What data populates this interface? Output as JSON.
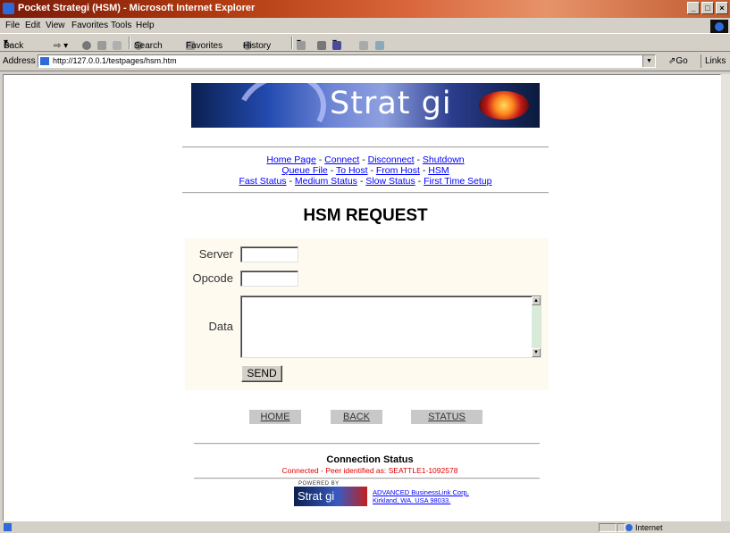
{
  "window": {
    "title": "Pocket Strategi (HSM) - Microsoft Internet Explorer",
    "controls": [
      "_",
      "□",
      "×"
    ]
  },
  "menu": [
    "File",
    "Edit",
    "View",
    "Favorites",
    "Tools",
    "Help"
  ],
  "toolbar": {
    "back": "Back",
    "search": "Search",
    "favorites": "Favorites",
    "history": "History"
  },
  "address": {
    "label": "Address",
    "url": "http://127.0.0.1/testpages/hsm.htm",
    "go": "Go",
    "links": "Links"
  },
  "page": {
    "logo_text": "Strat gi",
    "nav_row1": [
      "Home Page",
      "Connect",
      "Disconnect",
      "Shutdown"
    ],
    "nav_row2": [
      "Queue File",
      "To Host",
      "From Host",
      "HSM"
    ],
    "nav_row3": [
      "Fast Status",
      "Medium Status",
      "Slow Status",
      "First Time Setup"
    ],
    "separator": " - ",
    "heading": "HSM REQUEST",
    "form": {
      "server_label": "Server",
      "server_value": "",
      "opcode_label": "Opcode",
      "opcode_value": "",
      "data_label": "Data",
      "data_value": "",
      "send_label": "SEND"
    },
    "buttons": {
      "home": "HOME",
      "back": "BACK",
      "status": "STATUS"
    },
    "connection": {
      "heading": "Connection Status",
      "text": "Connected - Peer identified as: SEATTLE1-1092578"
    },
    "footer": {
      "powered": "POWERED BY",
      "logo_text": "Strat gi",
      "company_line1": "ADVANCED BusinessLink Corp.",
      "company_line2": "Kirkland, WA. USA 98033."
    }
  },
  "statusbar": {
    "zone": "Internet"
  }
}
